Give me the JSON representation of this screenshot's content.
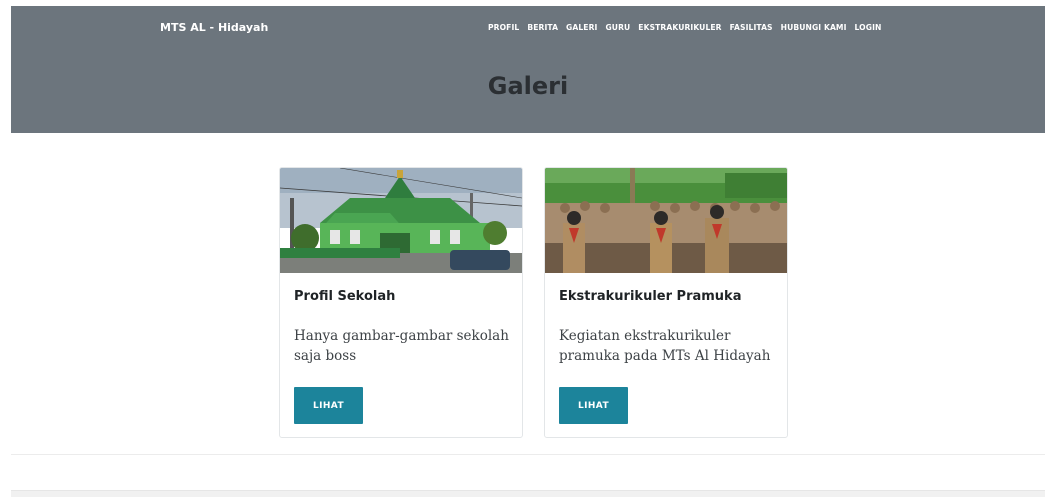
{
  "brand": "MTS AL - Hidayah",
  "nav": [
    "PROFIL",
    "BERITA",
    "GALERI",
    "GURU",
    "EKSTRAKURIKULER",
    "FASILITAS",
    "HUBUNGI KAMI",
    "LOGIN"
  ],
  "page_title": "Galeri",
  "cards": [
    {
      "title": "Profil Sekolah",
      "text": "Hanya gambar-gambar sekolah saja boss",
      "button": "LIHAT"
    },
    {
      "title": "Ekstrakurikuler Pramuka",
      "text": "Kegiatan ekstrakurikuler pramuka pada MTs Al Hidayah",
      "button": "LIHAT"
    }
  ],
  "colors": {
    "header_bg": "#6c757d",
    "button_bg": "#1c849b"
  }
}
